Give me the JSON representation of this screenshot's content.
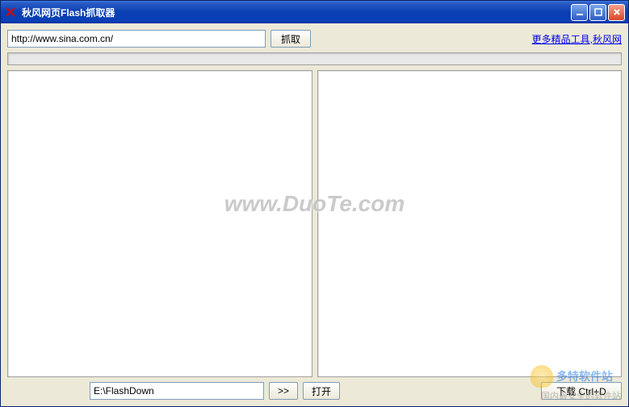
{
  "window": {
    "title": "秋风网页Flash抓取器"
  },
  "toolbar": {
    "url_value": "http://www.sina.com.cn/",
    "fetch_label": "抓取",
    "more_tools_link": "更多精品工具,秋风网"
  },
  "bottom": {
    "path_value": "E:\\FlashDown",
    "browse_label": ">>",
    "open_label": "打开",
    "download_label": "下载 Ctrl+D"
  },
  "watermark": {
    "main": "www.DuoTe.com",
    "logo": "多特软件站",
    "footer": "国内最安全的软件站"
  }
}
